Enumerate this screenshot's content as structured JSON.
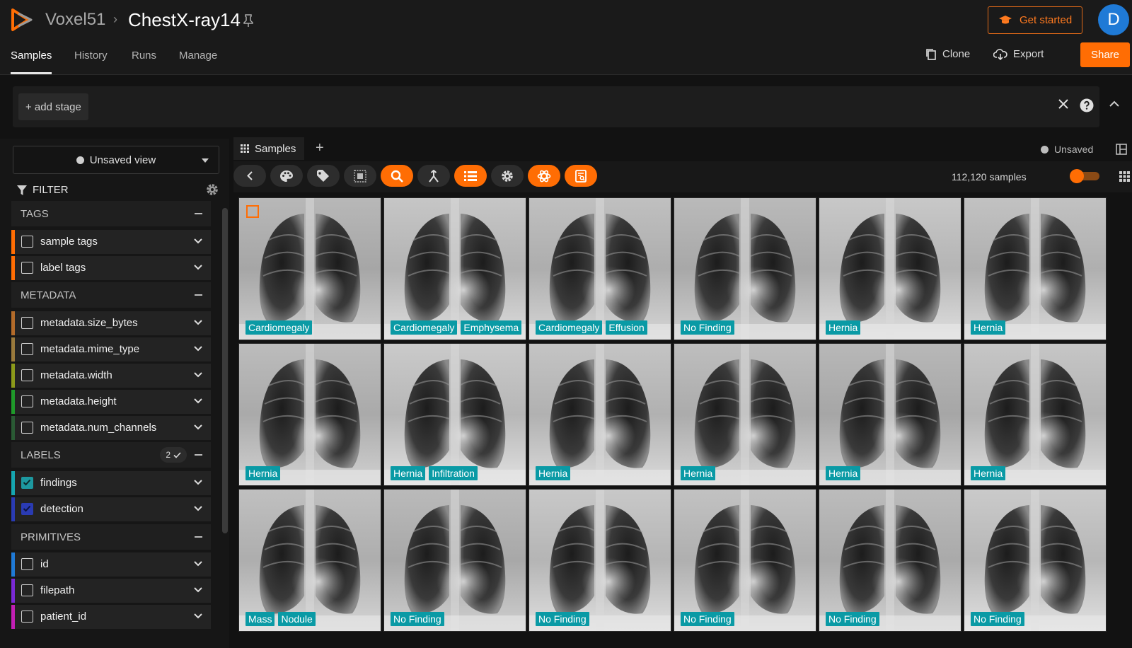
{
  "header": {
    "brand": "Voxel51",
    "crumb_sep": "›",
    "dataset_name": "ChestX-ray14",
    "get_started": "Get started",
    "avatar_initial": "D",
    "accent": "#ff6d04"
  },
  "nav": {
    "tabs": [
      "Samples",
      "History",
      "Runs",
      "Manage"
    ],
    "clone": "Clone",
    "export": "Export",
    "share": "Share"
  },
  "stage": {
    "add_stage": "+ add stage"
  },
  "sidebar": {
    "view": "Unsaved view",
    "filter": "FILTER",
    "groups": {
      "tags": "TAGS",
      "metadata": "METADATA",
      "labels": "LABELS",
      "labels_badge": "2",
      "primitives": "PRIMITIVES"
    },
    "items": [
      {
        "label": "sample tags",
        "color": "#ff6d04"
      },
      {
        "label": "label tags",
        "color": "#ff6d04"
      },
      {
        "label": "metadata.size_bytes",
        "color": "#b36b2a"
      },
      {
        "label": "metadata.mime_type",
        "color": "#9a7a3c"
      },
      {
        "label": "metadata.width",
        "color": "#8c9a1a"
      },
      {
        "label": "metadata.height",
        "color": "#1f9a2a"
      },
      {
        "label": "metadata.num_channels",
        "color": "#2a5a34"
      },
      {
        "label": "findings",
        "color": "#16a6b0"
      },
      {
        "label": "detection",
        "color": "#2a3bb3"
      },
      {
        "label": "id",
        "color": "#1f7ad6"
      },
      {
        "label": "filepath",
        "color": "#7a2ad6"
      },
      {
        "label": "patient_id",
        "color": "#c21fb4"
      }
    ]
  },
  "main": {
    "tab": "Samples",
    "unsaved": "Unsaved",
    "sample_count": "112,120 samples",
    "grid": [
      [
        "Cardiomegaly"
      ],
      [
        "Cardiomegaly",
        "Emphysema"
      ],
      [
        "Cardiomegaly",
        "Effusion"
      ],
      [
        "No Finding"
      ],
      [
        "Hernia"
      ],
      [
        "Hernia"
      ],
      [
        "Hernia"
      ],
      [
        "Hernia",
        "Infiltration"
      ],
      [
        "Hernia"
      ],
      [
        "Hernia"
      ],
      [
        "Hernia"
      ],
      [
        "Hernia"
      ],
      [
        "Mass",
        "Nodule"
      ],
      [
        "No Finding"
      ],
      [
        "No Finding"
      ],
      [
        "No Finding"
      ],
      [
        "No Finding"
      ],
      [
        "No Finding"
      ]
    ]
  }
}
